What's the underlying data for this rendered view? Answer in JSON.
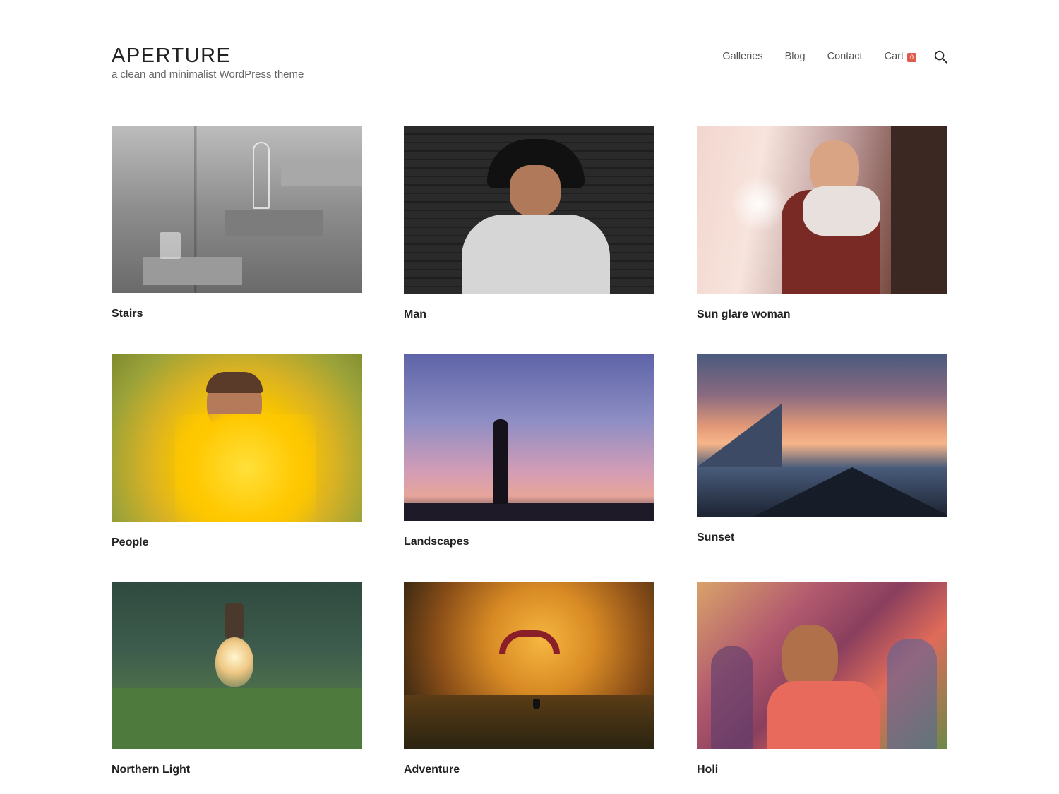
{
  "site": {
    "title": "APERTURE",
    "tagline": "a clean and minimalist WordPress theme"
  },
  "nav": {
    "items": [
      {
        "label": "Galleries"
      },
      {
        "label": "Blog"
      },
      {
        "label": "Contact"
      }
    ],
    "cart_label": "Cart",
    "cart_count": "0",
    "search_icon": "search-icon"
  },
  "colors": {
    "badge": "#e05a4d",
    "text": "#222222",
    "muted": "#666666"
  },
  "gallery": {
    "items": [
      {
        "title": "Stairs",
        "image": "stairs-photo"
      },
      {
        "title": "Man",
        "image": "man-photo"
      },
      {
        "title": "Sun glare woman",
        "image": "woman-photo"
      },
      {
        "title": "People",
        "image": "people-photo"
      },
      {
        "title": "Landscapes",
        "image": "landscape-photo"
      },
      {
        "title": "Sunset",
        "image": "sunset-photo"
      },
      {
        "title": "Northern Light",
        "image": "lightbulb-photo"
      },
      {
        "title": "Adventure",
        "image": "paraglider-photo"
      },
      {
        "title": "Holi",
        "image": "holi-photo"
      }
    ]
  }
}
